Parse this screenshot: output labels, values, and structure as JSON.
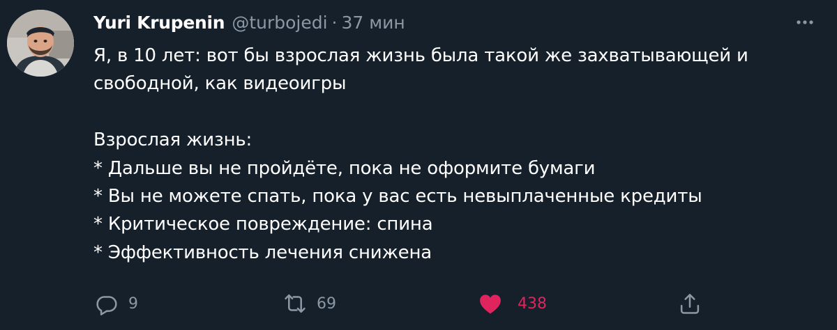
{
  "tweet": {
    "author": {
      "display_name": "Yuri Krupenin",
      "handle": "@turbojedi"
    },
    "separator": "·",
    "timestamp": "37 мин",
    "text": "Я, в 10 лет: вот бы взрослая жизнь была такой же захватывающей и\nсвободной, как видеоигры\n\nВзрослая жизнь:\n* Дальше вы не пройдёте, пока не оформите бумаги\n* Вы не можете спать, пока у вас есть невыплаченные кредиты\n* Критическое повреждение: спина\n* Эффективность лечения снижена",
    "actions": {
      "replies": "9",
      "retweets": "69",
      "likes": "438"
    }
  },
  "icons": {
    "more": "more-horizontal-icon",
    "reply": "reply-icon",
    "retweet": "retweet-icon",
    "like": "heart-icon",
    "share": "share-icon"
  },
  "colors": {
    "background": "#15202b",
    "text": "#ffffff",
    "secondary": "#8b98a5",
    "like": "#e0245e"
  }
}
